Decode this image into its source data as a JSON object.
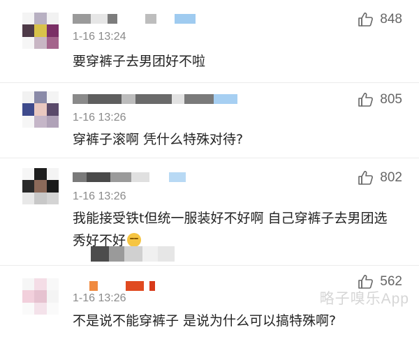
{
  "comments": [
    {
      "time": "1-16 13:24",
      "text": "要穿裤子去男团好不啦",
      "likes": "848"
    },
    {
      "time": "1-16 13:26",
      "text": "穿裤子滚啊  凭什么特殊对待?",
      "likes": "805"
    },
    {
      "time": "1-16 13:26",
      "text": "我能接受铁t但统一服装好不好啊 自己穿裤子去男团选秀好不好",
      "likes": "802"
    },
    {
      "time": "1-16 13:26",
      "text": "不是说不能穿裤子 是说为什么可以搞特殊啊?",
      "likes": "562"
    }
  ],
  "watermark": "略子嗅乐App",
  "icons": {
    "like": "thumbs-up-icon",
    "emoji": "smile-emoji-icon"
  }
}
